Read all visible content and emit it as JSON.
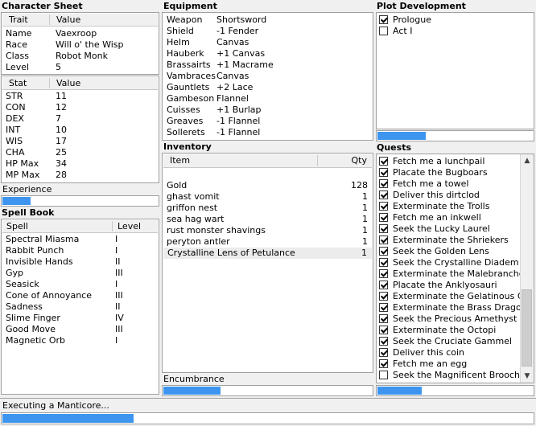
{
  "character_sheet": {
    "title": "Character Sheet",
    "trait_header": "Trait",
    "value_header": "Value",
    "traits": [
      {
        "trait": "Name",
        "value": "Vaexroop"
      },
      {
        "trait": "Race",
        "value": "Will o' the Wisp"
      },
      {
        "trait": "Class",
        "value": "Robot Monk"
      },
      {
        "trait": "Level",
        "value": "5"
      }
    ],
    "stat_header": "Stat",
    "stat_value_header": "Value",
    "stats": [
      {
        "stat": "STR",
        "value": "11"
      },
      {
        "stat": "CON",
        "value": "12"
      },
      {
        "stat": "DEX",
        "value": "7"
      },
      {
        "stat": "INT",
        "value": "10"
      },
      {
        "stat": "WIS",
        "value": "17"
      },
      {
        "stat": "CHA",
        "value": "25"
      },
      {
        "stat": "HP Max",
        "value": "34"
      },
      {
        "stat": "MP Max",
        "value": "28"
      }
    ],
    "experience_label": "Experience",
    "experience_progress": 0.19
  },
  "spell_book": {
    "title": "Spell Book",
    "spell_header": "Spell",
    "level_header": "Level",
    "spells": [
      {
        "name": "Spectral Miasma",
        "level": "I"
      },
      {
        "name": "Rabbit Punch",
        "level": "I"
      },
      {
        "name": "Invisible Hands",
        "level": "II"
      },
      {
        "name": "Gyp",
        "level": "III"
      },
      {
        "name": "Seasick",
        "level": "I"
      },
      {
        "name": "Cone of Annoyance",
        "level": "III"
      },
      {
        "name": "Sadness",
        "level": "II"
      },
      {
        "name": "Slime Finger",
        "level": "IV"
      },
      {
        "name": "Good Move",
        "level": "III"
      },
      {
        "name": "Magnetic Orb",
        "level": "I"
      }
    ]
  },
  "equipment": {
    "title": "Equipment",
    "items": [
      {
        "slot": "Weapon",
        "item": "Shortsword"
      },
      {
        "slot": "Shield",
        "item": "-1 Fender"
      },
      {
        "slot": "Helm",
        "item": "Canvas"
      },
      {
        "slot": "Hauberk",
        "item": "+1 Canvas"
      },
      {
        "slot": "Brassairts",
        "item": "+1 Macrame"
      },
      {
        "slot": "Vambraces",
        "item": "Canvas"
      },
      {
        "slot": "Gauntlets",
        "item": "+2 Lace"
      },
      {
        "slot": "Gambeson",
        "item": "Flannel"
      },
      {
        "slot": "Cuisses",
        "item": "+1 Burlap"
      },
      {
        "slot": "Greaves",
        "item": "-1 Flannel"
      },
      {
        "slot": "Sollerets",
        "item": "-1 Flannel"
      }
    ]
  },
  "inventory": {
    "title": "Inventory",
    "item_header": "Item",
    "qty_header": "Qty",
    "items": [
      {
        "name": "Gold",
        "qty": "128"
      },
      {
        "name": "ghast vomit",
        "qty": "1"
      },
      {
        "name": "griffon nest",
        "qty": "1"
      },
      {
        "name": "sea hag wart",
        "qty": "1"
      },
      {
        "name": "rust monster shavings",
        "qty": "1"
      },
      {
        "name": "peryton antler",
        "qty": "1"
      },
      {
        "name": "Crystalline Lens of Petulance",
        "qty": "1"
      }
    ],
    "encumbrance_label": "Encumbrance",
    "encumbrance_progress": 0.28
  },
  "plot": {
    "title": "Plot Development",
    "items": [
      {
        "label": "Prologue",
        "checked": true
      },
      {
        "label": "Act I",
        "checked": false
      }
    ],
    "progress": 0.32
  },
  "quests": {
    "title": "Quests",
    "items": [
      {
        "label": "Fetch me a lunchpail",
        "checked": true
      },
      {
        "label": "Placate the Bugboars",
        "checked": true
      },
      {
        "label": "Fetch me a towel",
        "checked": true
      },
      {
        "label": "Deliver this dirtclod",
        "checked": true
      },
      {
        "label": "Exterminate the Trolls",
        "checked": true
      },
      {
        "label": "Fetch me an inkwell",
        "checked": true
      },
      {
        "label": "Seek the Lucky Laurel",
        "checked": true
      },
      {
        "label": "Exterminate the Shriekers",
        "checked": true
      },
      {
        "label": "Seek the Golden Lens",
        "checked": true
      },
      {
        "label": "Seek the Crystalline Diadem",
        "checked": true
      },
      {
        "label": "Exterminate the Malebranches",
        "checked": true
      },
      {
        "label": "Placate the Anklyosauri",
        "checked": true
      },
      {
        "label": "Exterminate the Gelatinous Cubes",
        "checked": true
      },
      {
        "label": "Exterminate the Brass Dragons",
        "checked": true
      },
      {
        "label": "Seek the Precious Amethyst",
        "checked": true
      },
      {
        "label": "Exterminate the Octopi",
        "checked": true
      },
      {
        "label": "Seek the Cruciate Gammel",
        "checked": true
      },
      {
        "label": "Deliver this coin",
        "checked": true
      },
      {
        "label": "Fetch me an egg",
        "checked": true
      },
      {
        "label": "Seek the Magnificent Brooch",
        "checked": false
      }
    ],
    "progress": 0.29
  },
  "status": {
    "text": "Executing a Manticore...",
    "progress": 0.25
  },
  "colors": {
    "bar_fill": "#3d95f0"
  },
  "icons": {
    "scroll_up": "up-arrow-icon",
    "scroll_down": "down-arrow-icon",
    "check": "checkmark-icon"
  }
}
